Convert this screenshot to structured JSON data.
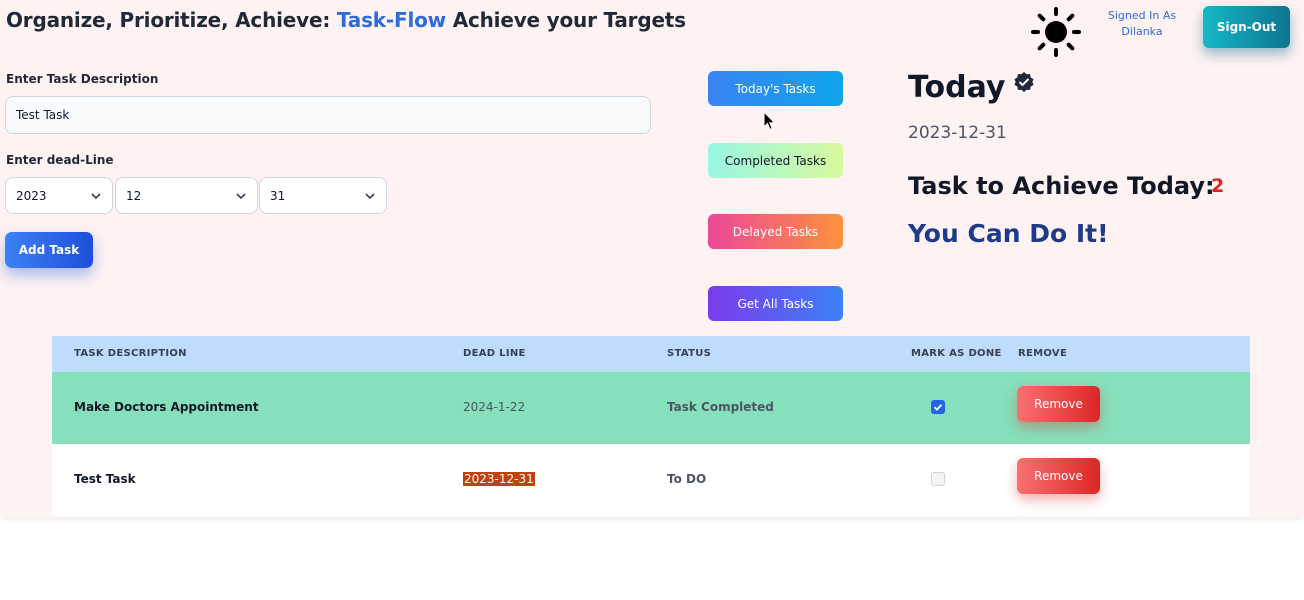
{
  "header": {
    "title_prefix": "Organize, Prioritize, Achieve:",
    "brand": "Task-Flow",
    "title_suffix": "Achieve your Targets",
    "signed_in_label": "Signed In As",
    "user_name": "Dilanka",
    "signout_label": "Sign-Out",
    "theme_icon": "sun-icon"
  },
  "form": {
    "desc_label": "Enter Task Description",
    "desc_value": "Test Task",
    "deadline_label": "Enter dead-Line",
    "year": "2023",
    "month": "12",
    "day": "31",
    "add_label": "Add Task"
  },
  "filters": {
    "today": "Today's Tasks",
    "completed": "Completed Tasks",
    "delayed": "Delayed Tasks",
    "all": "Get All Tasks"
  },
  "summary": {
    "heading": "Today",
    "date": "2023-12-31",
    "achieve_label": "Task to Achieve Today:",
    "achieve_count": "2",
    "motivation": "You Can Do It!"
  },
  "table": {
    "headers": {
      "desc": "Task Description",
      "deadline": "Dead Line",
      "status": "Status",
      "mark": "Mark As Done",
      "remove": "Remove"
    },
    "rows": [
      {
        "desc": "Make Doctors Appointment",
        "deadline": "2024-1-22",
        "status": "Task Completed",
        "done": true,
        "remove_label": "Remove"
      },
      {
        "desc": "Test Task",
        "deadline": "2023-12-31",
        "status": "To DO",
        "done": false,
        "remove_label": "Remove"
      }
    ]
  },
  "colors": {
    "brand": "#2b6cd8",
    "completed_row": "#86e0bb",
    "header_row": "#bfdbfe",
    "count": "#dc2626",
    "motivation": "#1e3a8a"
  }
}
